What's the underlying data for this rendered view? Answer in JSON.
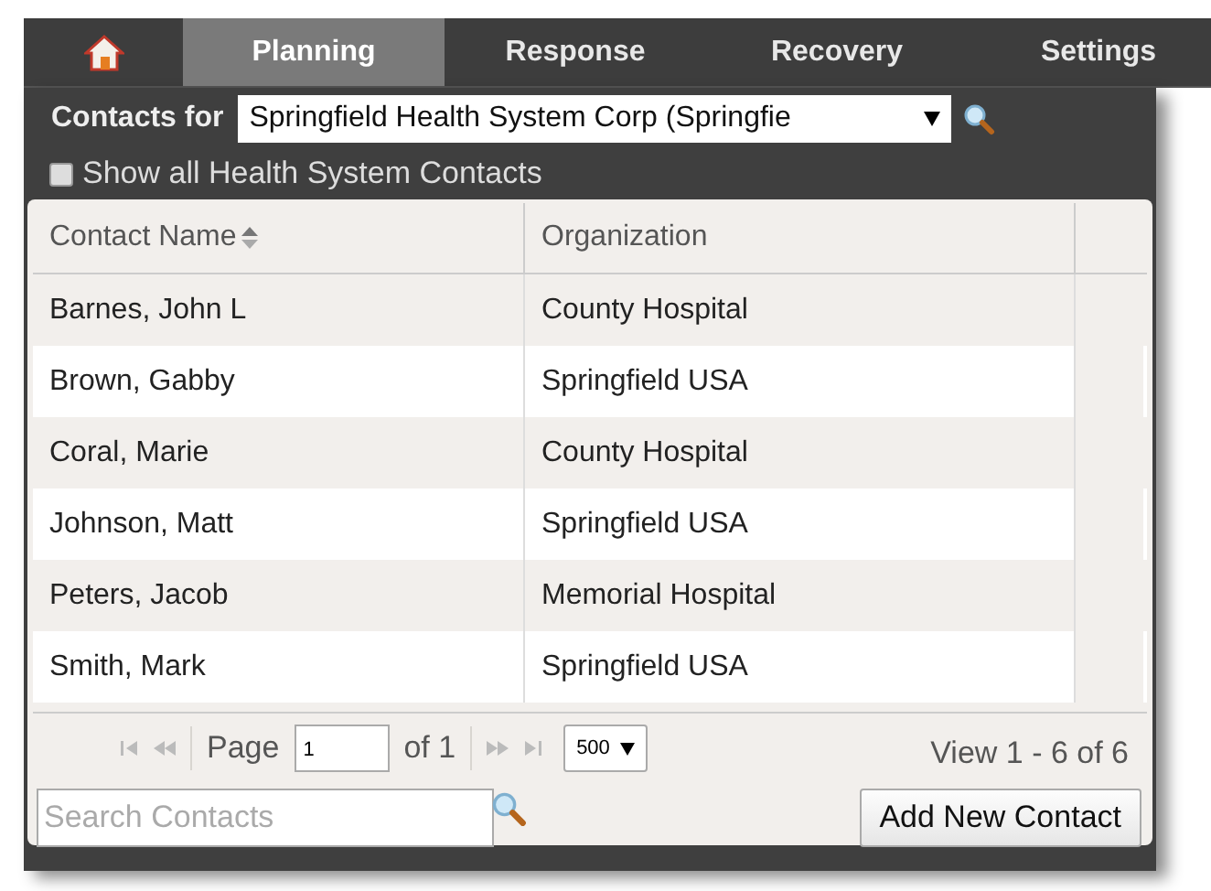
{
  "tabs": [
    {
      "kind": "home",
      "selected": false
    },
    {
      "kind": "text",
      "label": "Planning",
      "selected": true
    },
    {
      "kind": "text",
      "label": "Response",
      "selected": false
    },
    {
      "kind": "text",
      "label": "Recovery",
      "selected": false
    },
    {
      "kind": "text",
      "label": "Settings",
      "selected": false
    }
  ],
  "contacts_for": {
    "label": "Contacts for",
    "value": "Springfield Health System Corp (Springfie"
  },
  "show_all": {
    "label": "Show all Health System Contacts",
    "checked": false
  },
  "table": {
    "columns": [
      "Contact Name",
      "Organization"
    ],
    "rows": [
      [
        "Barnes, John L",
        "County Hospital"
      ],
      [
        "Brown, Gabby",
        "Springfield USA"
      ],
      [
        "Coral, Marie",
        "County Hospital"
      ],
      [
        "Johnson, Matt",
        "Springfield USA"
      ],
      [
        "Peters, Jacob",
        "Memorial Hospital"
      ],
      [
        "Smith, Mark",
        "Springfield USA"
      ]
    ]
  },
  "pager": {
    "page_label": "Page",
    "page": "1",
    "of": "of 1",
    "page_size": "500",
    "summary": "View 1 - 6 of 6"
  },
  "search": {
    "placeholder": "Search Contacts"
  },
  "add_button": "Add New Contact"
}
